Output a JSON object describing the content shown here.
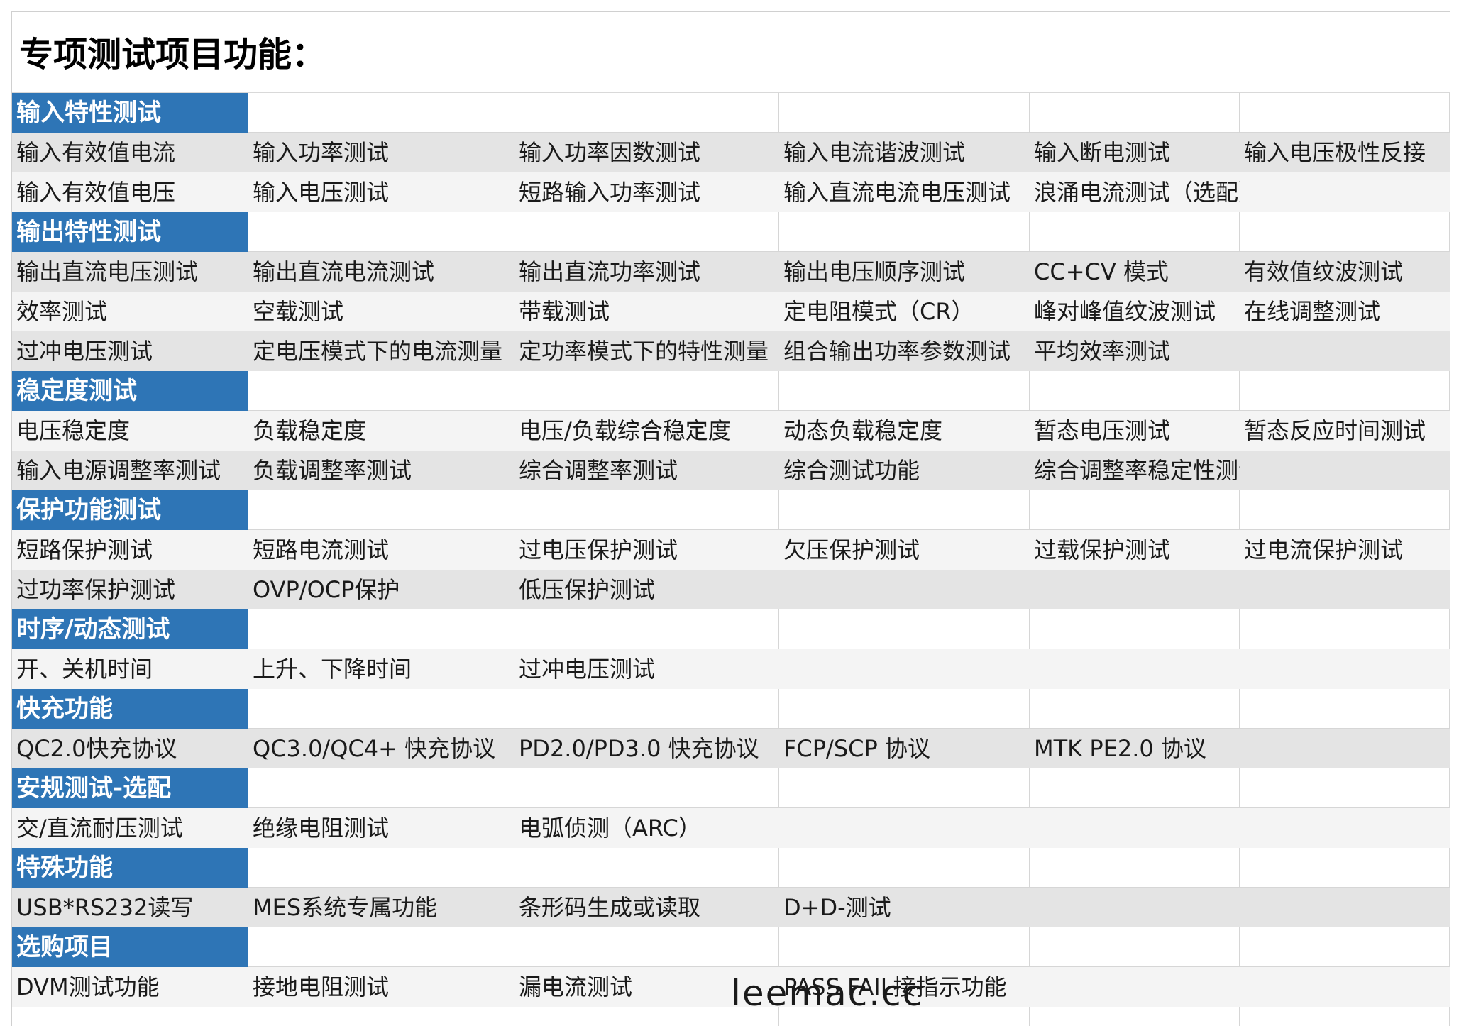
{
  "page_title": "专项测试项目功能：",
  "sections": [
    {
      "header": "输入特性测试",
      "rows": [
        [
          "输入有效值电流",
          "输入功率测试",
          "输入功率因数测试",
          "输入电流谐波测试",
          "输入断电测试",
          "输入电压极性反接"
        ],
        [
          "输入有效值电压",
          "输入电压测试",
          "短路输入功率测试",
          "输入直流电流电压测试",
          "浪涌电流测试（选配）",
          ""
        ]
      ]
    },
    {
      "header": "输出特性测试",
      "rows": [
        [
          "输出直流电压测试",
          "输出直流电流测试",
          "输出直流功率测试",
          "输出电压顺序测试",
          "CC+CV 模式",
          "有效值纹波测试"
        ],
        [
          "效率测试",
          "空载测试",
          "带载测试",
          "定电阻模式（CR）",
          "峰对峰值纹波测试",
          "在线调整测试"
        ],
        [
          "过冲电压测试",
          "定电压模式下的电流测量",
          "定功率模式下的特性测量",
          "组合输出功率参数测试",
          "平均效率测试",
          ""
        ]
      ]
    },
    {
      "header": "稳定度测试",
      "rows": [
        [
          "电压稳定度",
          "负载稳定度",
          "电压/负载综合稳定度",
          "动态负载稳定度",
          "暂态电压测试",
          "暂态反应时间测试"
        ],
        [
          "输入电源调整率测试",
          "负载调整率测试",
          "综合调整率测试",
          "综合测试功能",
          "综合调整率稳定性测试",
          ""
        ]
      ]
    },
    {
      "header": "保护功能测试",
      "rows": [
        [
          "短路保护测试",
          "短路电流测试",
          "过电压保护测试",
          "欠压保护测试",
          "过载保护测试",
          "过电流保护测试"
        ],
        [
          "过功率保护测试",
          "OVP/OCP保护",
          "低压保护测试",
          "",
          "",
          ""
        ]
      ]
    },
    {
      "header": "时序/动态测试",
      "rows": [
        [
          "开、关机时间",
          "上升、下降时间",
          "过冲电压测试",
          "",
          "",
          ""
        ]
      ]
    },
    {
      "header": "快充功能",
      "rows": [
        [
          "QC2.0快充协议",
          "QC3.0/QC4+ 快充协议",
          "PD2.0/PD3.0 快充协议",
          "FCP/SCP 协议",
          "MTK PE2.0 协议",
          ""
        ]
      ]
    },
    {
      "header": "安规测试-选配",
      "rows": [
        [
          "交/直流耐压测试",
          "绝缘电阻测试",
          "电弧侦测（ARC）",
          "",
          "",
          ""
        ]
      ]
    },
    {
      "header": "特殊功能",
      "rows": [
        [
          "USB*RS232读写",
          "MES系统专属功能",
          "条形码生成或读取",
          "D+D-测试",
          "",
          ""
        ]
      ]
    },
    {
      "header": "选购项目",
      "rows": [
        [
          "DVM测试功能",
          "接地电阻测试",
          "漏电流测试",
          "PASS FAIL接指示功能",
          "",
          ""
        ]
      ]
    }
  ],
  "watermark": "leemac.cc",
  "colors": {
    "header_bg": "#2e75b6",
    "header_text": "#ffffff",
    "row_alt_bg": "#e4e4e4",
    "row_plain_bg": "#f4f4f4"
  }
}
